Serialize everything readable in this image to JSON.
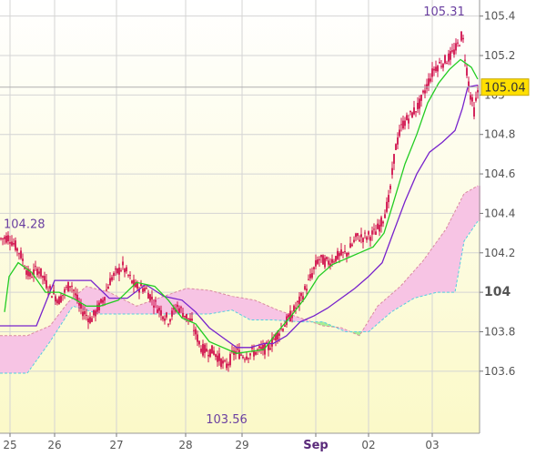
{
  "chart_data": {
    "type": "candlestick",
    "indicator": "Ichimoku Kinko Hyo",
    "x_tick_labels": [
      "25",
      "26",
      "27",
      "28",
      "29",
      "Sep",
      "02",
      "03"
    ],
    "y_tick_labels": [
      "105.4",
      "105.2",
      "105",
      "104.8",
      "104.6",
      "104.4",
      "104.2",
      "104",
      "103.8",
      "103.6"
    ],
    "ylim": [
      103.47,
      105.44
    ],
    "y_ticks": [
      105.4,
      105.2,
      105.0,
      104.8,
      104.6,
      104.4,
      104.2,
      104.0,
      103.8,
      103.6
    ],
    "grid": true,
    "annotations": {
      "high": {
        "label": "105.31",
        "value": 105.31
      },
      "low": {
        "label": "103.56",
        "value": 103.56
      },
      "start": {
        "label": "104.28",
        "value": 104.28
      }
    },
    "current_price": {
      "label": "105.04",
      "value": 105.04
    },
    "colors": {
      "candle": "#d0104c",
      "tenkan": "#22cc22",
      "kijun": "#7722cc",
      "cloud_bearish": "#f7c4e4",
      "cloud_bullish": "#a8ee94",
      "annotation_text": "#6a3fa0",
      "price_box": "#ffdf00",
      "axis_text": "#555555",
      "background_top": "#ffffff",
      "background_bottom": "#fbf9c8"
    },
    "price_path": [
      [
        0,
        104.27
      ],
      [
        10,
        104.28
      ],
      [
        22,
        104.2
      ],
      [
        32,
        104.08
      ],
      [
        42,
        104.12
      ],
      [
        55,
        104.01
      ],
      [
        65,
        103.96
      ],
      [
        78,
        104.05
      ],
      [
        88,
        103.92
      ],
      [
        100,
        103.86
      ],
      [
        112,
        103.95
      ],
      [
        122,
        104.07
      ],
      [
        135,
        104.13
      ],
      [
        148,
        104.03
      ],
      [
        160,
        104.02
      ],
      [
        172,
        103.93
      ],
      [
        185,
        103.86
      ],
      [
        195,
        103.93
      ],
      [
        210,
        103.85
      ],
      [
        222,
        103.71
      ],
      [
        235,
        103.7
      ],
      [
        248,
        103.62
      ],
      [
        258,
        103.7
      ],
      [
        268,
        103.68
      ],
      [
        282,
        103.7
      ],
      [
        295,
        103.72
      ],
      [
        305,
        103.79
      ],
      [
        318,
        103.87
      ],
      [
        330,
        103.96
      ],
      [
        340,
        104.06
      ],
      [
        350,
        104.17
      ],
      [
        360,
        104.15
      ],
      [
        370,
        104.18
      ],
      [
        382,
        104.2
      ],
      [
        392,
        104.28
      ],
      [
        402,
        104.28
      ],
      [
        412,
        104.3
      ],
      [
        420,
        104.36
      ],
      [
        428,
        104.48
      ],
      [
        434,
        104.72
      ],
      [
        442,
        104.85
      ],
      [
        452,
        104.9
      ],
      [
        462,
        104.96
      ],
      [
        470,
        105.06
      ],
      [
        478,
        105.14
      ],
      [
        488,
        105.17
      ],
      [
        496,
        105.2
      ],
      [
        503,
        105.25
      ],
      [
        508,
        105.31
      ],
      [
        512,
        105.16
      ],
      [
        517,
        105.0
      ],
      [
        521,
        104.92
      ],
      [
        526,
        105.04
      ]
    ],
    "tenkan_path": [
      [
        5,
        103.9
      ],
      [
        10,
        104.08
      ],
      [
        20,
        104.15
      ],
      [
        35,
        104.1
      ],
      [
        50,
        104.0
      ],
      [
        65,
        104.0
      ],
      [
        80,
        103.97
      ],
      [
        95,
        103.93
      ],
      [
        110,
        103.93
      ],
      [
        130,
        103.96
      ],
      [
        150,
        104.05
      ],
      [
        170,
        104.03
      ],
      [
        185,
        103.96
      ],
      [
        200,
        103.87
      ],
      [
        215,
        103.84
      ],
      [
        230,
        103.75
      ],
      [
        245,
        103.72
      ],
      [
        260,
        103.69
      ],
      [
        275,
        103.7
      ],
      [
        290,
        103.71
      ],
      [
        305,
        103.8
      ],
      [
        320,
        103.88
      ],
      [
        335,
        103.97
      ],
      [
        350,
        104.08
      ],
      [
        365,
        104.14
      ],
      [
        380,
        104.17
      ],
      [
        395,
        104.2
      ],
      [
        410,
        104.23
      ],
      [
        422,
        104.3
      ],
      [
        432,
        104.45
      ],
      [
        445,
        104.65
      ],
      [
        458,
        104.8
      ],
      [
        470,
        104.96
      ],
      [
        482,
        105.06
      ],
      [
        494,
        105.13
      ],
      [
        506,
        105.18
      ],
      [
        518,
        105.14
      ],
      [
        525,
        105.08
      ]
    ],
    "kijun_path": [
      [
        0,
        103.83
      ],
      [
        20,
        103.83
      ],
      [
        40,
        103.83
      ],
      [
        60,
        104.06
      ],
      [
        80,
        104.06
      ],
      [
        100,
        104.06
      ],
      [
        120,
        103.97
      ],
      [
        140,
        103.97
      ],
      [
        160,
        104.04
      ],
      [
        180,
        103.98
      ],
      [
        200,
        103.96
      ],
      [
        215,
        103.9
      ],
      [
        230,
        103.82
      ],
      [
        245,
        103.77
      ],
      [
        260,
        103.72
      ],
      [
        275,
        103.72
      ],
      [
        290,
        103.74
      ],
      [
        300,
        103.74
      ],
      [
        315,
        103.78
      ],
      [
        330,
        103.85
      ],
      [
        345,
        103.88
      ],
      [
        360,
        103.92
      ],
      [
        375,
        103.97
      ],
      [
        390,
        104.02
      ],
      [
        405,
        104.08
      ],
      [
        420,
        104.15
      ],
      [
        432,
        104.3
      ],
      [
        445,
        104.46
      ],
      [
        458,
        104.6
      ],
      [
        472,
        104.71
      ],
      [
        486,
        104.76
      ],
      [
        500,
        104.82
      ],
      [
        508,
        104.93
      ],
      [
        514,
        105.04
      ],
      [
        525,
        105.05
      ]
    ],
    "span_a_path": [
      [
        0,
        103.78
      ],
      [
        30,
        103.78
      ],
      [
        55,
        103.83
      ],
      [
        75,
        103.95
      ],
      [
        95,
        104.03
      ],
      [
        120,
        104.0
      ],
      [
        150,
        103.93
      ],
      [
        180,
        103.98
      ],
      [
        205,
        104.02
      ],
      [
        230,
        104.01
      ],
      [
        255,
        103.98
      ],
      [
        280,
        103.96
      ],
      [
        305,
        103.91
      ],
      [
        330,
        103.87
      ],
      [
        355,
        103.83
      ],
      [
        375,
        103.82
      ],
      [
        395,
        103.78
      ],
      [
        415,
        103.93
      ],
      [
        440,
        104.03
      ],
      [
        465,
        104.16
      ],
      [
        490,
        104.32
      ],
      [
        510,
        104.5
      ],
      [
        525,
        104.54
      ]
    ],
    "span_b_path": [
      [
        0,
        103.59
      ],
      [
        30,
        103.59
      ],
      [
        55,
        103.75
      ],
      [
        80,
        103.93
      ],
      [
        110,
        103.89
      ],
      [
        140,
        103.89
      ],
      [
        170,
        103.89
      ],
      [
        200,
        103.89
      ],
      [
        230,
        103.89
      ],
      [
        255,
        103.91
      ],
      [
        275,
        103.86
      ],
      [
        300,
        103.86
      ],
      [
        330,
        103.85
      ],
      [
        355,
        103.85
      ],
      [
        380,
        103.8
      ],
      [
        405,
        103.8
      ],
      [
        430,
        103.9
      ],
      [
        455,
        103.97
      ],
      [
        480,
        104.0
      ],
      [
        500,
        104.0
      ],
      [
        510,
        104.26
      ],
      [
        525,
        104.36
      ]
    ]
  }
}
